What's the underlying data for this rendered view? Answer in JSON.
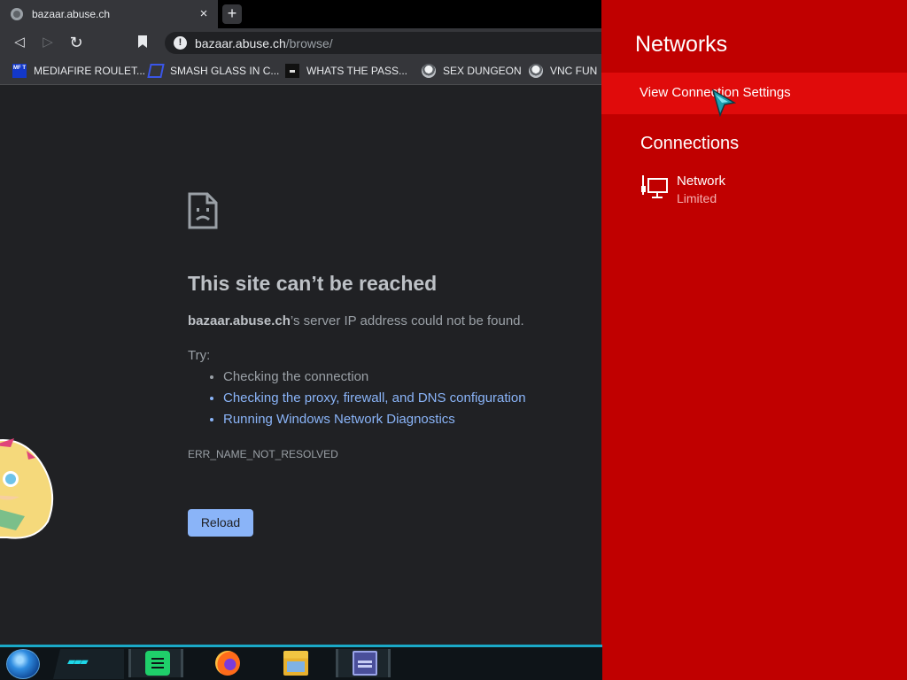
{
  "browser": {
    "tab": {
      "title": "bazaar.abuse.ch",
      "close_glyph": "×",
      "favicon": "globe-icon"
    },
    "new_tab_glyph": "+",
    "nav": {
      "back_glyph": "◁",
      "forward_glyph": "▷",
      "reload_glyph": "↻"
    },
    "address": {
      "host": "bazaar.abuse.ch",
      "path": "/browse/",
      "security_glyph": "!"
    },
    "bookmarks": [
      {
        "label": "MEDIAFIRE ROULET...",
        "icon": "mediafire-icon",
        "icon_text": "MF T"
      },
      {
        "label": "SMASH GLASS IN C...",
        "icon": "smash-glass-icon"
      },
      {
        "label": "WHATS THE PASS...",
        "icon": "password-icon"
      },
      {
        "label": "SEX DUNGEON",
        "icon": "dungeon-icon"
      },
      {
        "label": "VNC FUN",
        "icon": "vnc-icon"
      }
    ],
    "error": {
      "title": "This site can’t be reached",
      "host_bold": "bazaar.abuse.ch",
      "description_rest": "’s server IP address could not be found.",
      "try_label": "Try:",
      "suggestions": [
        "Checking the connection",
        "Checking the proxy, firewall, and DNS configuration",
        "Running Windows Network Diagnostics"
      ],
      "code": "ERR_NAME_NOT_RESOLVED",
      "reload_label": "Reload"
    }
  },
  "networks": {
    "title": "Networks",
    "view_settings": "View Connection Settings",
    "connections_heading": "Connections",
    "connection": {
      "name": "Network",
      "status": "Limited",
      "icon": "wired-network-icon"
    }
  },
  "taskbar": {
    "apps": [
      "notes-icon",
      "firefox-icon",
      "file-explorer-icon",
      "window-app-icon"
    ]
  },
  "colors": {
    "flyout_bg": "#c00000",
    "flyout_highlight": "#e00b0b",
    "link": "#8ab4f8",
    "page_bg": "#202124",
    "taskbar_accent": "#1aa9c7"
  }
}
